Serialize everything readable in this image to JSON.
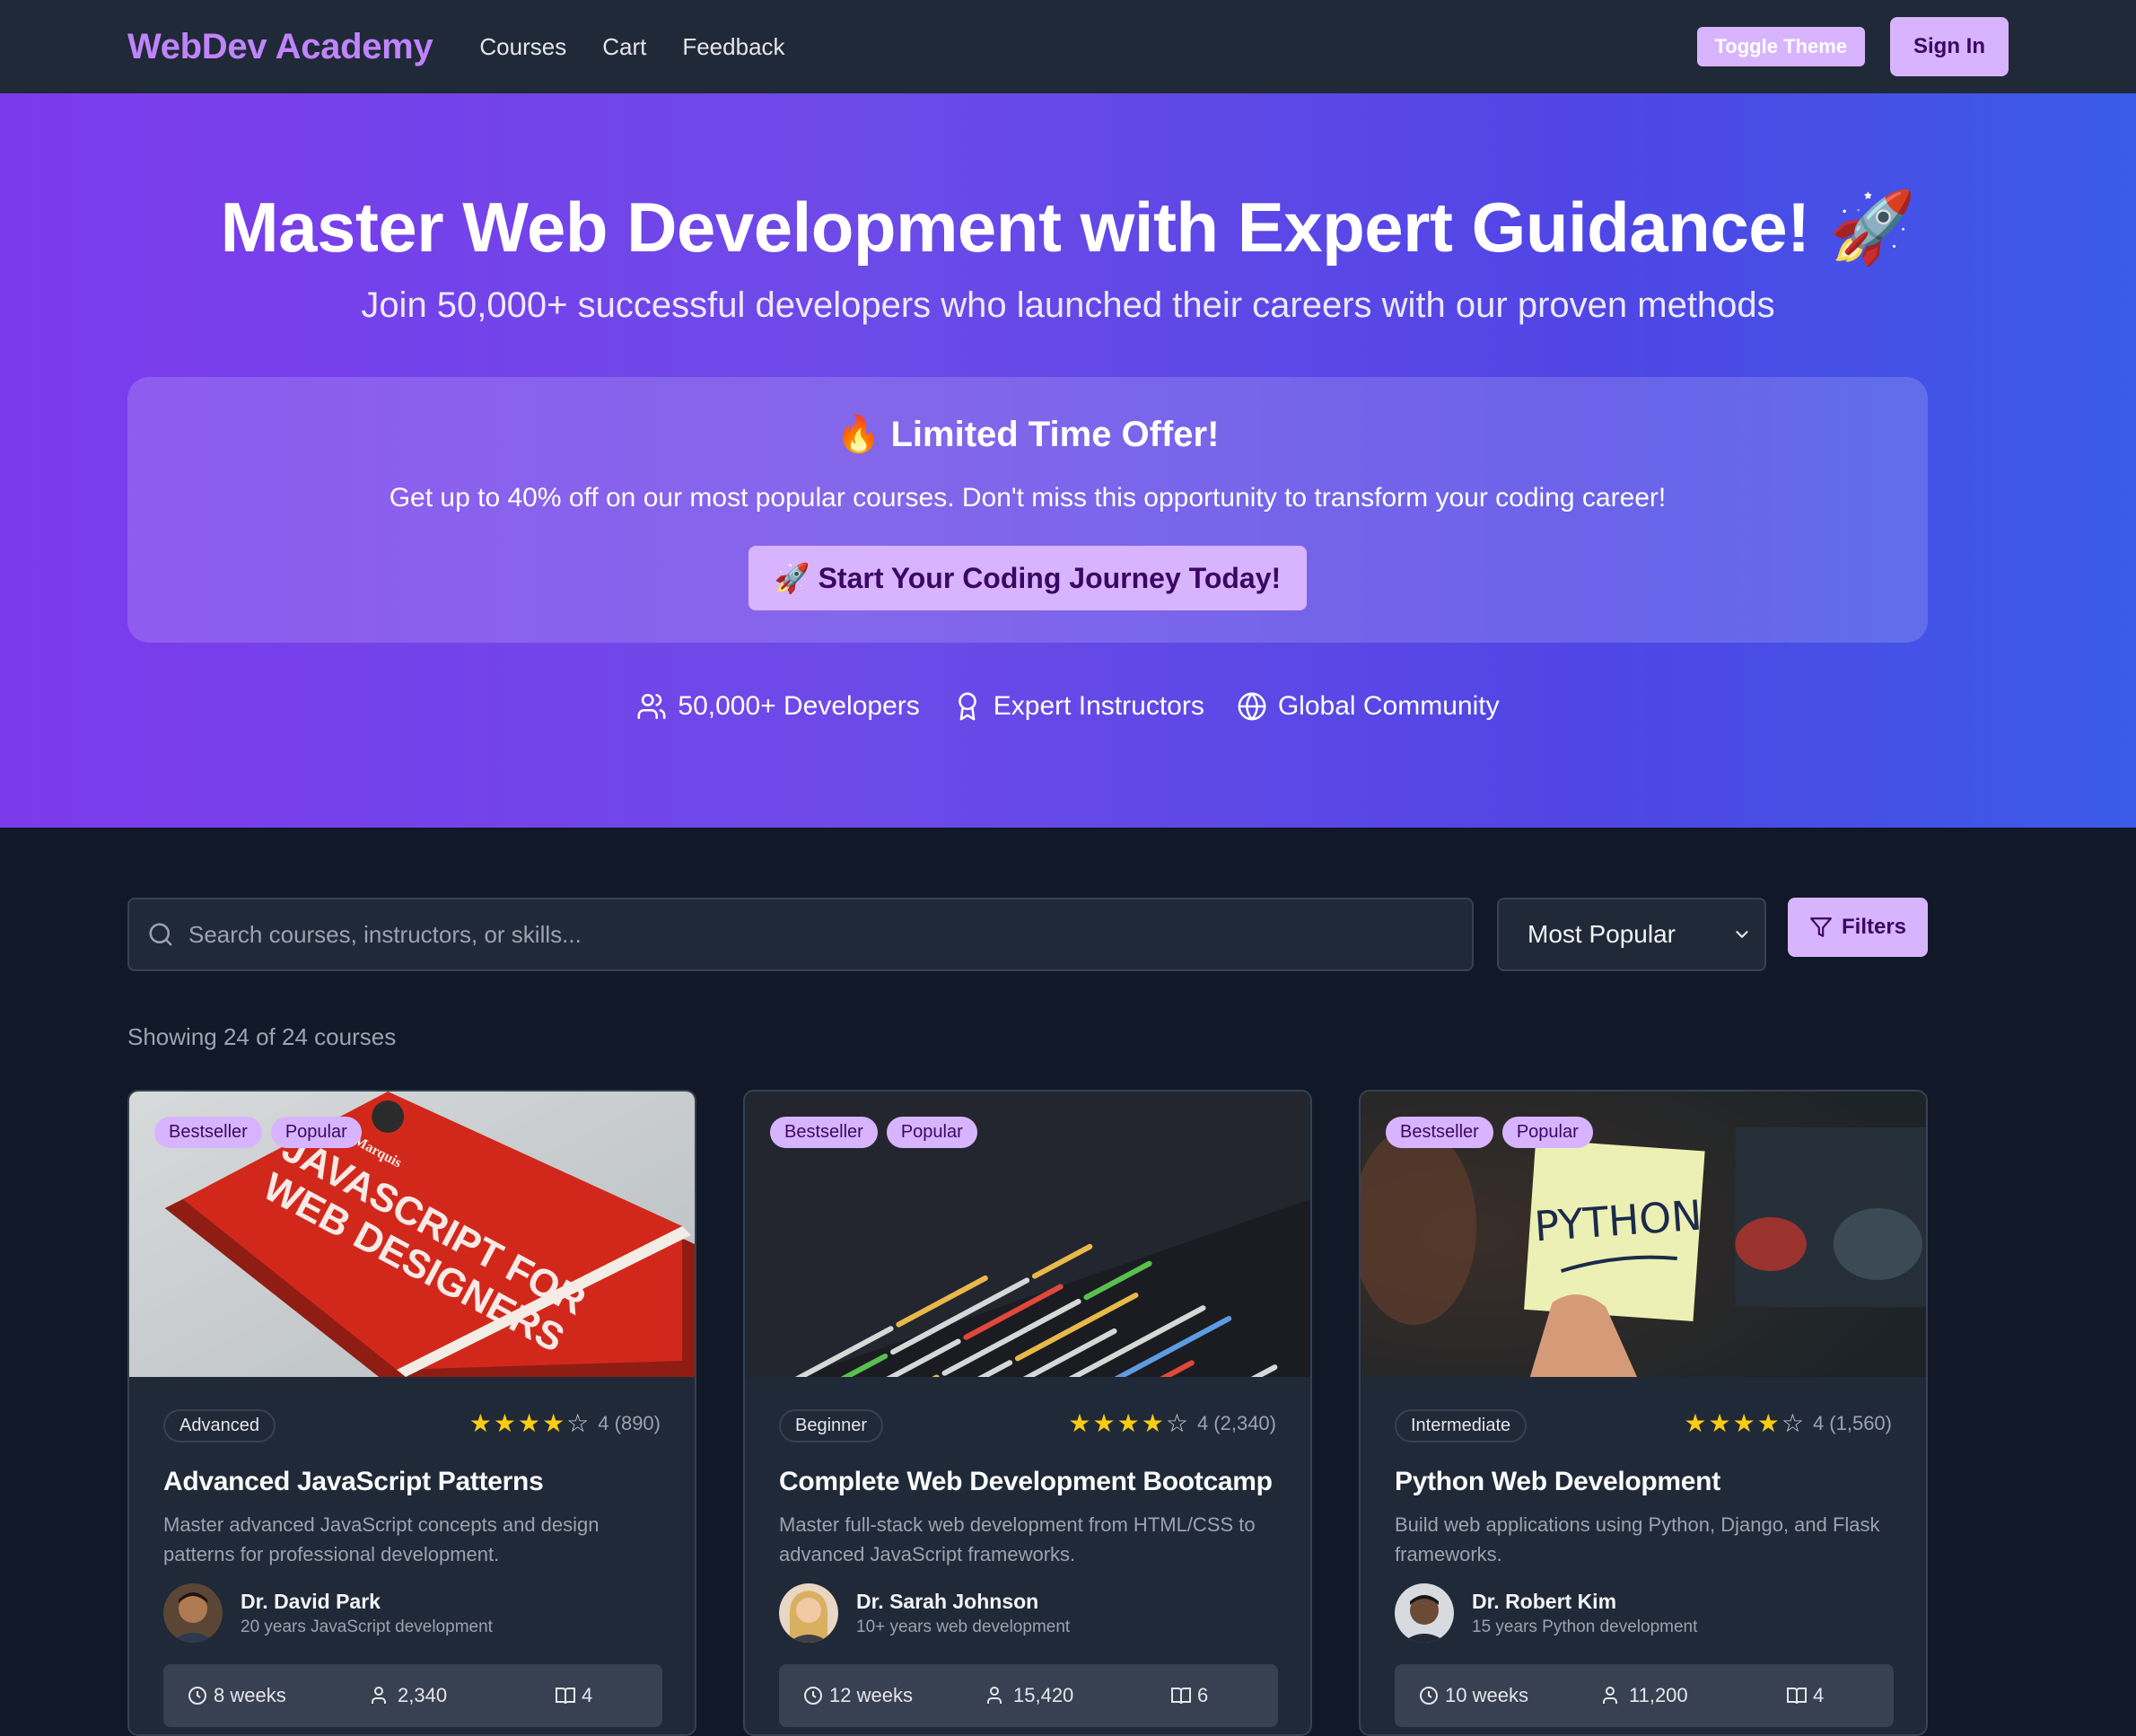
{
  "nav": {
    "brand": "WebDev Academy",
    "links": [
      "Courses",
      "Cart",
      "Feedback"
    ],
    "toggle_theme": "Toggle Theme",
    "sign_in": "Sign In"
  },
  "hero": {
    "title": "Master Web Development with Expert Guidance! 🚀",
    "subtitle": "Join 50,000+ successful developers who launched their careers with our proven methods",
    "offer": {
      "title": "🔥 Limited Time Offer!",
      "text": "Get up to 40% off on our most popular courses. Don't miss this opportunity to transform your coding career!",
      "cta": "🚀 Start Your Coding Journey Today!"
    },
    "stats": [
      {
        "icon": "users-icon",
        "label": "50,000+ Developers"
      },
      {
        "icon": "award-icon",
        "label": "Expert Instructors"
      },
      {
        "icon": "globe-icon",
        "label": "Global Community"
      }
    ]
  },
  "controls": {
    "search_placeholder": "Search courses, instructors, or skills...",
    "sort_value": "Most Popular",
    "filters_label": "Filters",
    "showing": "Showing 24 of 24 courses"
  },
  "courses": [
    {
      "badges": [
        "Bestseller",
        "Popular"
      ],
      "level": "Advanced",
      "rating": 4,
      "rating_text": "4 (890)",
      "title": "Advanced JavaScript Patterns",
      "description": "Master advanced JavaScript concepts and design patterns for professional development.",
      "instructor": "Dr. David Park",
      "experience": "20 years JavaScript development",
      "duration": "8 weeks",
      "students": "2,340",
      "modules": "4"
    },
    {
      "badges": [
        "Bestseller",
        "Popular"
      ],
      "level": "Beginner",
      "rating": 4,
      "rating_text": "4 (2,340)",
      "title": "Complete Web Development Bootcamp",
      "description": "Master full-stack web development from HTML/CSS to advanced JavaScript frameworks.",
      "instructor": "Dr. Sarah Johnson",
      "experience": "10+ years web development",
      "duration": "12 weeks",
      "students": "15,420",
      "modules": "6"
    },
    {
      "badges": [
        "Bestseller",
        "Popular"
      ],
      "level": "Intermediate",
      "rating": 4,
      "rating_text": "4 (1,560)",
      "title": "Python Web Development",
      "description": "Build web applications using Python, Django, and Flask frameworks.",
      "instructor": "Dr. Robert Kim",
      "experience": "15 years Python development",
      "duration": "10 weeks",
      "students": "11,200",
      "modules": "4"
    }
  ],
  "images": {
    "book_cover_text": "JAVASCRIPT FOR WEB DESIGNERS",
    "book_author": "Mat Marquis",
    "note_text": "PYTHON"
  },
  "colors": {
    "accent": "#d8b4fe",
    "brand": "#c084fc",
    "background": "#111827",
    "surface": "#1f2937",
    "star": "#facc15"
  }
}
